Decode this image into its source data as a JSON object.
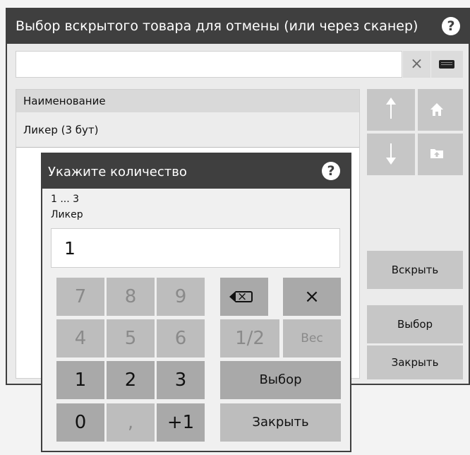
{
  "window": {
    "title": "Выбор вскрытого товара для отмены (или через сканер)",
    "help": "?",
    "search": {
      "value": "",
      "clear": "×"
    },
    "table": {
      "header": "Наименование",
      "rows": [
        "Ликер (3 бут)"
      ]
    },
    "buttons": {
      "open": "Вскрыть",
      "select": "Выбор",
      "close": "Закрыть"
    }
  },
  "dialog": {
    "title": "Укажите количество",
    "help": "?",
    "range": "1 ... 3",
    "product": "Ликер",
    "value": "1",
    "keys": {
      "k7": "7",
      "k8": "8",
      "k9": "9",
      "k4": "4",
      "k5": "5",
      "k6": "6",
      "k1": "1",
      "k2": "2",
      "k3": "3",
      "k0": "0",
      "comma": ",",
      "plus1": "+1",
      "clear": "×",
      "half": "1/2",
      "weight": "Вес",
      "select": "Выбор",
      "close": "Закрыть"
    }
  }
}
